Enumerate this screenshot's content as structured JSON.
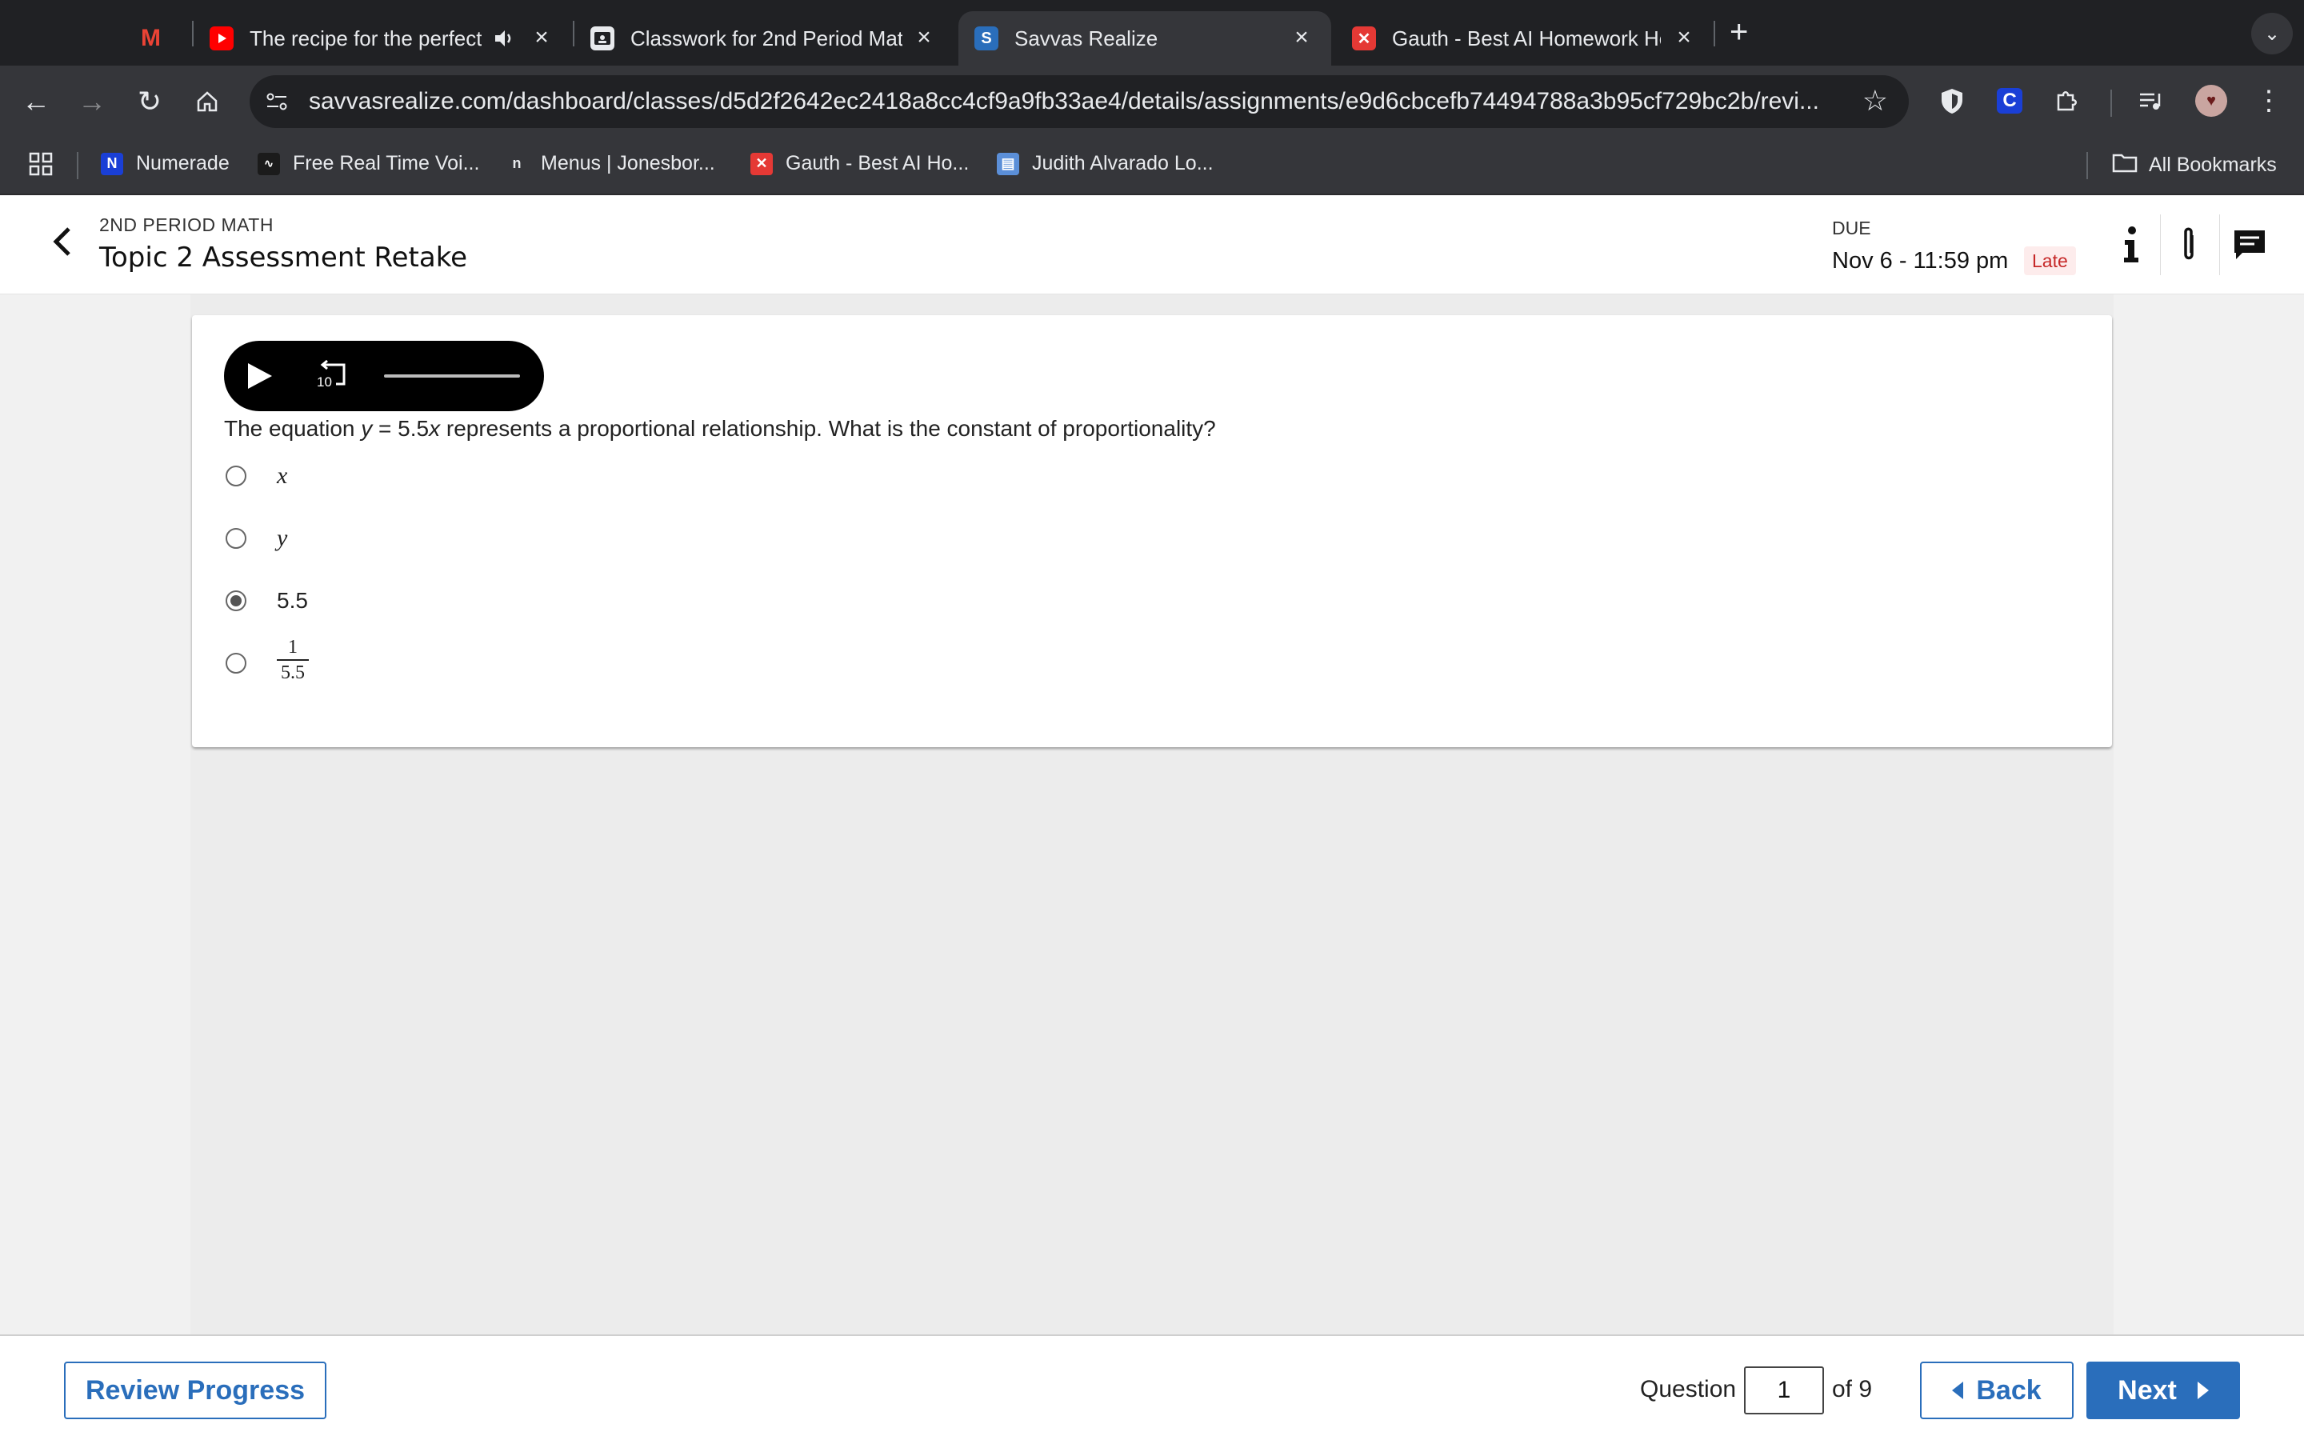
{
  "browser": {
    "tabs": [
      {
        "title": "The recipe for the perfect",
        "icon": "youtube-icon"
      },
      {
        "title": "Classwork for 2nd Period Mat",
        "icon": "classroom-icon"
      },
      {
        "title": "Savvas Realize",
        "icon": "savvas-icon"
      },
      {
        "title": "Gauth - Best AI Homework He",
        "icon": "gauth-icon"
      }
    ],
    "pinned_tab_icon": "gmail-icon",
    "url": "savvasrealize.com/dashboard/classes/d5d2f2642ec2418a8cc4cf9a9fb33ae4/details/assignments/e9d6cbcefb74494788a3b95cf729bc2b/revi...",
    "extension_c_label": "C",
    "bookmarks": [
      {
        "label": "Numerade"
      },
      {
        "label": "Free Real Time Voi..."
      },
      {
        "label": "Menus | Jonesbor..."
      },
      {
        "label": "Gauth - Best AI Ho..."
      },
      {
        "label": "Judith Alvarado Lo..."
      }
    ],
    "all_bookmarks": "All Bookmarks"
  },
  "header": {
    "class_name": "2ND PERIOD MATH",
    "title": "Topic 2 Assessment Retake",
    "due_label": "DUE",
    "due_date": "Nov 6 - 11:59 pm",
    "late_badge": "Late"
  },
  "audio": {
    "replay_label": "10"
  },
  "question": {
    "prefix": "The equation ",
    "var_y": "y",
    "middle": " = 5.5",
    "var_x": "x",
    "suffix": " represents a proportional relationship. What is the constant of proportionality?",
    "choices": [
      {
        "label": "x",
        "selected": false
      },
      {
        "label": "y",
        "selected": false
      },
      {
        "label": "5.5",
        "selected": true
      },
      {
        "numerator": "1",
        "denominator": "5.5",
        "selected": false
      }
    ]
  },
  "footer": {
    "review_progress": "Review Progress",
    "question_label": "Question",
    "question_value": "1",
    "of_total": "of 9",
    "back_label": "Back",
    "next_label": "Next"
  },
  "colors": {
    "brand_blue": "#2a6ebb",
    "late_red": "#c62828",
    "late_bg": "#fdecec",
    "chrome_dark": "#202124",
    "chrome_toolbar": "#35363a"
  }
}
